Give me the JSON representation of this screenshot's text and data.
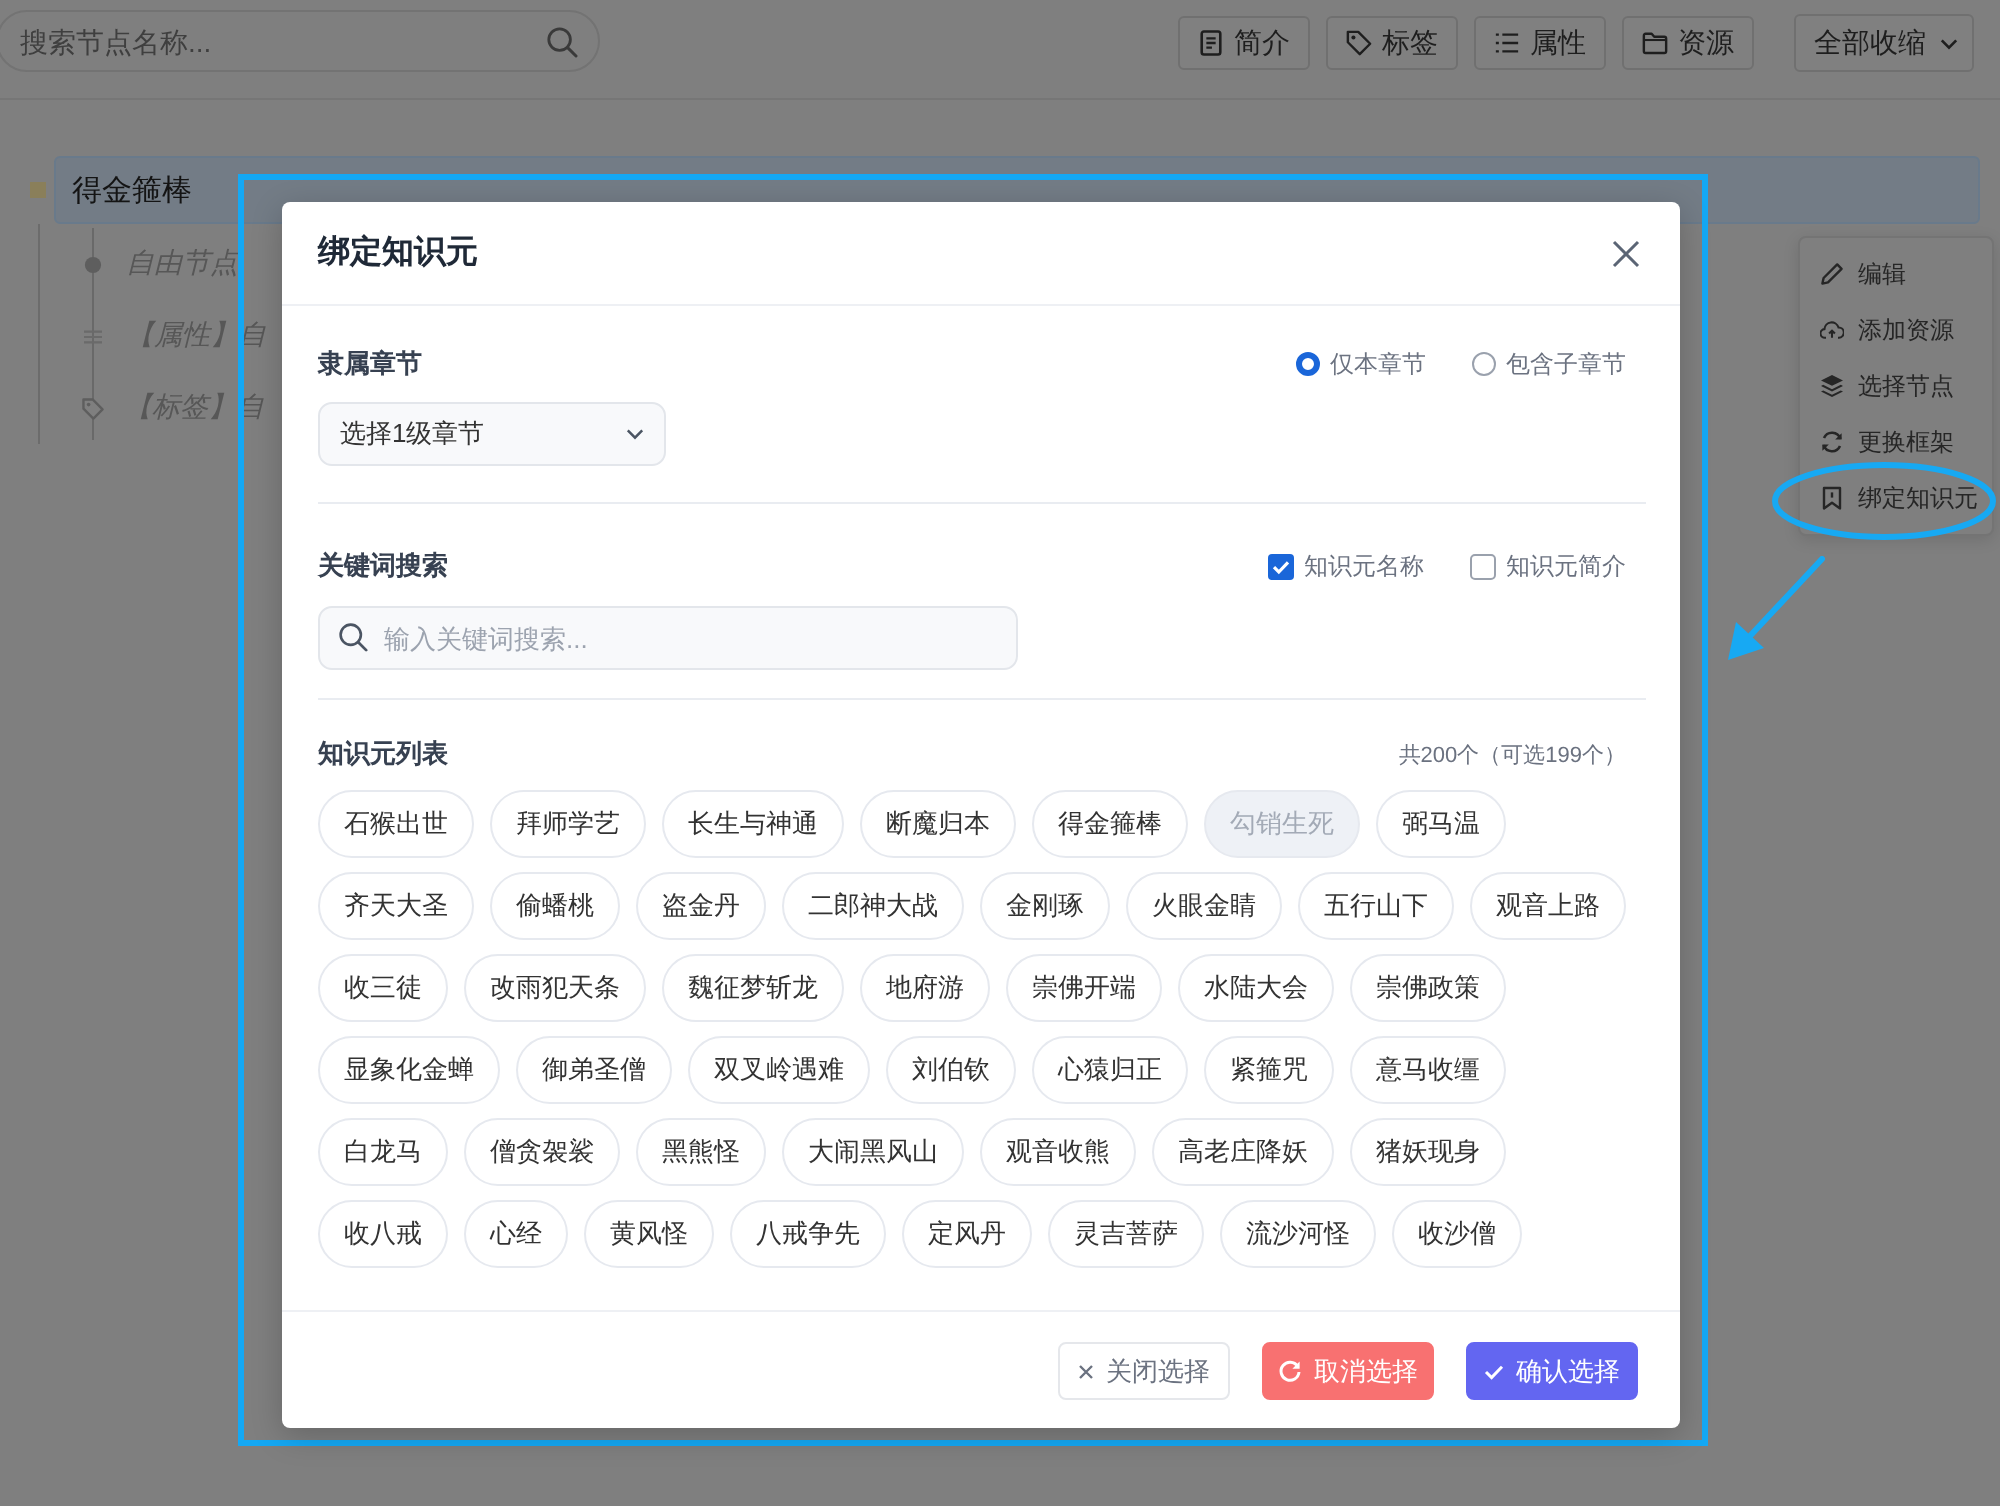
{
  "toolbar": {
    "search": {
      "placeholder": "搜索节点名称..."
    },
    "buttons": [
      {
        "label": "简介",
        "kind": "doc"
      },
      {
        "label": "标签",
        "kind": "tag"
      },
      {
        "label": "属性",
        "kind": "list"
      },
      {
        "label": "资源",
        "kind": "folder"
      }
    ],
    "collapse_select": {
      "value": "全部收缩"
    }
  },
  "tree": {
    "root": {
      "label": "得金箍棒",
      "children": [
        {
          "label": "自由节点",
          "kind": "plain"
        },
        {
          "label": "【属性】自",
          "kind": "attribute"
        },
        {
          "label": "【标签】自",
          "kind": "tag"
        }
      ]
    }
  },
  "context_menu": {
    "items": [
      {
        "label": "编辑",
        "kind": "edit",
        "circled": false
      },
      {
        "label": "添加资源",
        "kind": "upload",
        "circled": false
      },
      {
        "label": "选择节点",
        "kind": "layers",
        "circled": false
      },
      {
        "label": "更换框架",
        "kind": "swap",
        "circled": false
      },
      {
        "label": "绑定知识元",
        "kind": "bind",
        "circled": true
      }
    ]
  },
  "dialog": {
    "title": "绑定知识元",
    "chapter": {
      "label": "隶属章节",
      "scope_options": [
        {
          "label": "仅本章节",
          "selected": true
        },
        {
          "label": "包含子章节",
          "selected": false
        }
      ],
      "select": {
        "value": "选择1级章节"
      }
    },
    "keyword": {
      "label": "关键词搜索",
      "fields": [
        {
          "label": "知识元名称",
          "checked": true
        },
        {
          "label": "知识元简介",
          "checked": false
        }
      ],
      "search": {
        "placeholder": "输入关键词搜索..."
      }
    },
    "list": {
      "label": "知识元列表",
      "count": "共200个（可选199个）",
      "items": [
        {
          "label": "石猴出世",
          "disabled": false
        },
        {
          "label": "拜师学艺",
          "disabled": false
        },
        {
          "label": "长生与神通",
          "disabled": false
        },
        {
          "label": "断魔归本",
          "disabled": false
        },
        {
          "label": "得金箍棒",
          "disabled": false
        },
        {
          "label": "勾销生死",
          "disabled": true
        },
        {
          "label": "弼马温",
          "disabled": false
        },
        {
          "label": "齐天大圣",
          "disabled": false
        },
        {
          "label": "偷蟠桃",
          "disabled": false
        },
        {
          "label": "盗金丹",
          "disabled": false
        },
        {
          "label": "二郎神大战",
          "disabled": false
        },
        {
          "label": "金刚琢",
          "disabled": false
        },
        {
          "label": "火眼金睛",
          "disabled": false
        },
        {
          "label": "五行山下",
          "disabled": false
        },
        {
          "label": "观音上路",
          "disabled": false
        },
        {
          "label": "收三徒",
          "disabled": false
        },
        {
          "label": "改雨犯天条",
          "disabled": false
        },
        {
          "label": "魏征梦斩龙",
          "disabled": false
        },
        {
          "label": "地府游",
          "disabled": false
        },
        {
          "label": "崇佛开端",
          "disabled": false
        },
        {
          "label": "水陆大会",
          "disabled": false
        },
        {
          "label": "崇佛政策",
          "disabled": false
        },
        {
          "label": "显象化金蝉",
          "disabled": false
        },
        {
          "label": "御弟圣僧",
          "disabled": false
        },
        {
          "label": "双叉岭遇难",
          "disabled": false
        },
        {
          "label": "刘伯钦",
          "disabled": false
        },
        {
          "label": "心猿归正",
          "disabled": false
        },
        {
          "label": "紧箍咒",
          "disabled": false
        },
        {
          "label": "意马收缰",
          "disabled": false
        },
        {
          "label": "白龙马",
          "disabled": false
        },
        {
          "label": "僧贪袈裟",
          "disabled": false
        },
        {
          "label": "黑熊怪",
          "disabled": false
        },
        {
          "label": "大闹黑风山",
          "disabled": false
        },
        {
          "label": "观音收熊",
          "disabled": false
        },
        {
          "label": "高老庄降妖",
          "disabled": false
        },
        {
          "label": "猪妖现身",
          "disabled": false
        },
        {
          "label": "收八戒",
          "disabled": false
        },
        {
          "label": "心经",
          "disabled": false
        },
        {
          "label": "黄风怪",
          "disabled": false
        },
        {
          "label": "八戒争先",
          "disabled": false
        },
        {
          "label": "定风丹",
          "disabled": false
        },
        {
          "label": "灵吉菩萨",
          "disabled": false
        },
        {
          "label": "流沙河怪",
          "disabled": false
        },
        {
          "label": "收沙僧",
          "disabled": false
        }
      ]
    },
    "buttons": [
      {
        "label": "关闭选择",
        "kind": "close"
      },
      {
        "label": "取消选择",
        "kind": "reset"
      },
      {
        "label": "确认选择",
        "kind": "confirm"
      }
    ]
  }
}
